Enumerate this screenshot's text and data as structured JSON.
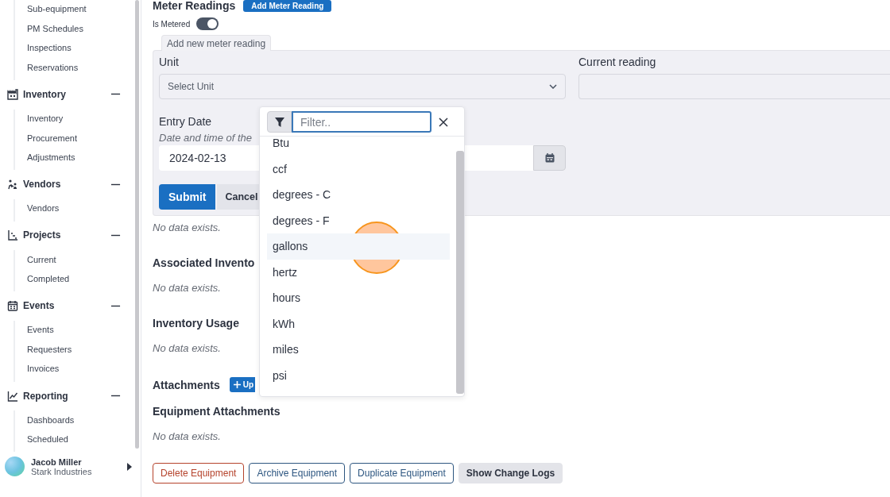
{
  "sidebar": {
    "groups": [
      {
        "items": [
          "Sub-equipment",
          "PM Schedules",
          "Inspections",
          "Reservations"
        ]
      },
      {
        "title": "Inventory",
        "expanded": true,
        "items": [
          "Inventory",
          "Procurement",
          "Adjustments"
        ]
      },
      {
        "title": "Vendors",
        "expanded": true,
        "items": [
          "Vendors"
        ]
      },
      {
        "title": "Projects",
        "expanded": true,
        "items": [
          "Current",
          "Completed"
        ]
      },
      {
        "title": "Events",
        "expanded": true,
        "items": [
          "Events",
          "Requesters",
          "Invoices"
        ]
      },
      {
        "title": "Reporting",
        "expanded": true,
        "items": [
          "Dashboards",
          "Scheduled"
        ]
      }
    ],
    "user": {
      "name": "Jacob Miller",
      "company": "Stark Industries"
    }
  },
  "main": {
    "section_title": "Meter Readings",
    "add_button": "Add Meter Reading",
    "metered": {
      "label": "Is Metered",
      "on": true
    },
    "form": {
      "legend": "Add new meter reading",
      "unit_label": "Unit",
      "unit_placeholder": "Select Unit",
      "current_label": "Current reading",
      "date_label": "Entry Date",
      "date_hint": "Date and time of the",
      "date_value": "2024-02-13",
      "submit": "Submit",
      "cancel": "Cancel"
    },
    "meter_empty": "No data exists.",
    "dropdown": {
      "filter_placeholder": "Filter..",
      "options": [
        {
          "label": "Btu",
          "highlighted": false
        },
        {
          "label": "ccf",
          "highlighted": false
        },
        {
          "label": "degrees - C",
          "highlighted": false
        },
        {
          "label": "degrees - F",
          "highlighted": false
        },
        {
          "label": "gallons",
          "highlighted": true
        },
        {
          "label": "hertz",
          "highlighted": false
        },
        {
          "label": "hours",
          "highlighted": false
        },
        {
          "label": "kWh",
          "highlighted": false
        },
        {
          "label": "miles",
          "highlighted": false
        },
        {
          "label": "psi",
          "highlighted": false
        }
      ]
    },
    "sections": [
      {
        "title": "Associated Invento",
        "empty": "No data exists."
      },
      {
        "title": "Inventory Usage",
        "empty": "No data exists."
      },
      {
        "title": "Attachments",
        "button": "Up"
      },
      {
        "title": "Equipment Attachments",
        "empty": "No data exists."
      }
    ],
    "actions": [
      {
        "label": "Delete Equipment",
        "kind": "danger"
      },
      {
        "label": "Archive Equipment",
        "kind": "outline"
      },
      {
        "label": "Duplicate Equipment",
        "kind": "outline"
      },
      {
        "label": "Show Change Logs",
        "kind": "secondary"
      }
    ]
  }
}
